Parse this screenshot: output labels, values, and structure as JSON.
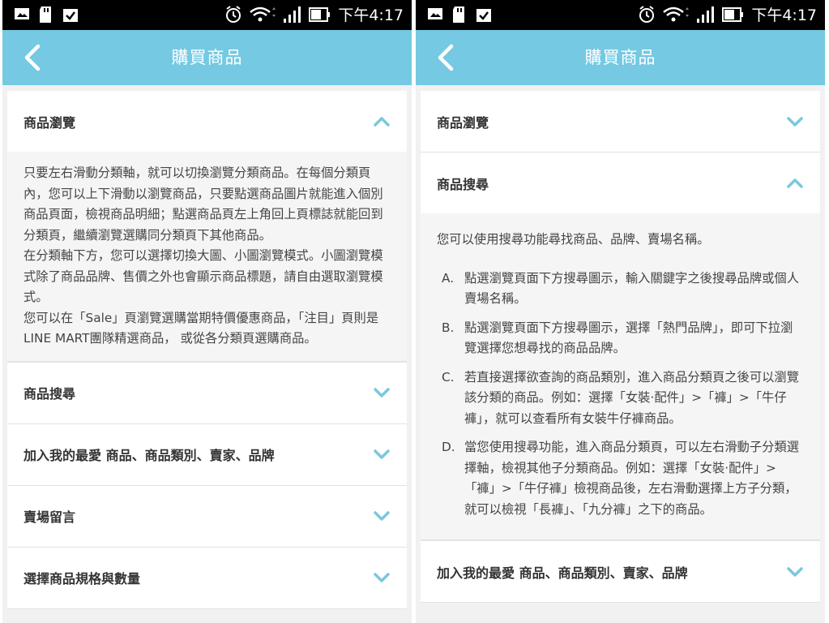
{
  "status": {
    "time": "下午4:17"
  },
  "colors": {
    "header": "#75c9e2",
    "chevron": "#7ac8dd"
  },
  "left": {
    "title": "購買商品",
    "expanded": {
      "title": "商品瀏覽",
      "paragraphs": [
        "只要左右滑動分類軸，就可以切換瀏覽分類商品。在每個分類頁內，您可以上下滑動以瀏覽商品，只要點選商品圖片就能進入個別商品頁面，檢視商品明細；點選商品頁左上角回上頁標誌就能回到分類頁，繼續瀏覽選購同分類頁下其他商品。",
        "在分類軸下方，您可以選擇切換大圖、小圖瀏覽模式。小圖瀏覽模式除了商品品牌、售價之外也會顯示商品標題，請自由選取瀏覽模式。",
        "您可以在「Sale」頁瀏覽選購當期特價優惠商品，「注目」頁則是LINE MART團隊精選商品， 或從各分類頁選購商品。"
      ]
    },
    "items": [
      "商品搜尋",
      "加入我的最愛 商品、商品類別、賣家、品牌",
      "賣場留言",
      "選擇商品規格與數量"
    ]
  },
  "right": {
    "title": "購買商品",
    "collapsed_first": "商品瀏覽",
    "expanded": {
      "title": "商品搜尋",
      "intro": "您可以使用搜尋功能尋找商品、品牌、賣場名稱。",
      "list": [
        {
          "marker": "A.",
          "text": "點選瀏覽頁面下方搜尋圖示，輸入關鍵字之後搜尋品牌或個人賣場名稱。"
        },
        {
          "marker": "B.",
          "text": "點選瀏覽頁面下方搜尋圖示，選擇「熱門品牌」，即可下拉瀏覽選擇您想尋找的商品品牌。"
        },
        {
          "marker": "C.",
          "text": "若直接選擇欲查詢的商品類別，進入商品分類頁之後可以瀏覽該分類的商品。例如：選擇「女裝·配件」>「褲」>「牛仔褲」，就可以查看所有女裝牛仔褲商品。"
        },
        {
          "marker": "D.",
          "text": "當您使用搜尋功能，進入商品分類頁，可以左右滑動子分類選擇軸，檢視其他子分類商品。例如：選擇「女裝·配件」>「褲」>「牛仔褲」檢視商品後，左右滑動選擇上方子分類，就可以檢視「長褲」、「九分褲」之下的商品。"
        }
      ]
    },
    "items": [
      "加入我的最愛 商品、商品類別、賣家、品牌"
    ]
  }
}
